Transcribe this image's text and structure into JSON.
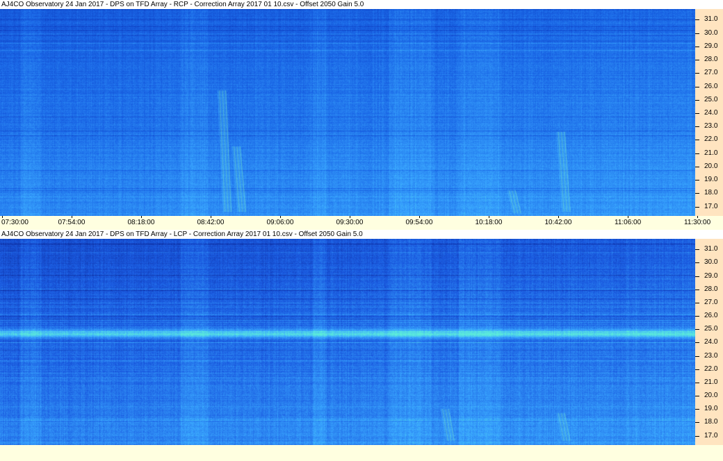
{
  "chart_data": [
    {
      "type": "heatmap",
      "title": "AJ4CO Observatory 24 Jan 2017  -  DPS on TFD Array  -  RCP  -  Correction Array 2017 01 10.csv  -  Offset 2050  Gain 5.0",
      "xlabel": "",
      "ylabel": "",
      "x_ticks": [
        "07:30:00",
        "07:54:00",
        "08:18:00",
        "08:42:00",
        "09:06:00",
        "09:30:00",
        "09:54:00",
        "10:18:00",
        "10:42:00",
        "11:06:00",
        "11:30:00"
      ],
      "y_ticks": [
        "31.0",
        "30.0",
        "29.0",
        "28.0",
        "27.0",
        "26.0",
        "25.0",
        "24.0",
        "23.0",
        "22.0",
        "21.0",
        "20.0",
        "19.0",
        "18.0",
        "17.0"
      ],
      "y_tick_values": [
        31,
        30,
        29,
        28,
        27,
        26,
        25,
        24,
        23,
        22,
        21,
        20,
        19,
        18,
        17
      ],
      "ylim": [
        16.3,
        31.8
      ],
      "xlim_minutes": [
        0,
        240
      ],
      "colors": {
        "deep": "#0a2fb4",
        "mid": "#1a66e6",
        "bright": "#3aa8ff",
        "hot": "#5ef0d8"
      },
      "bursts": [
        {
          "t_min": 78,
          "f_lo": 16.6,
          "f_hi": 25.7
        },
        {
          "t_min": 83,
          "f_lo": 16.6,
          "f_hi": 21.5
        },
        {
          "t_min": 178,
          "f_lo": 16.5,
          "f_hi": 18.2
        },
        {
          "t_min": 195,
          "f_lo": 16.6,
          "f_hi": 22.6
        }
      ]
    },
    {
      "type": "heatmap",
      "title": "AJ4CO Observatory 24 Jan 2017  -  DPS on TFD Array  -  LCP  -  Correction Array 2017 01 10.csv  -  Offset 2050  Gain 5.0",
      "xlabel": "",
      "ylabel": "",
      "x_ticks": [],
      "y_ticks": [
        "31.0",
        "30.0",
        "29.0",
        "28.0",
        "27.0",
        "26.0",
        "25.0",
        "24.0",
        "23.0",
        "22.0",
        "21.0",
        "20.0",
        "19.0",
        "18.0",
        "17.0"
      ],
      "y_tick_values": [
        31,
        30,
        29,
        28,
        27,
        26,
        25,
        24,
        23,
        22,
        21,
        20,
        19,
        18,
        17
      ],
      "ylim": [
        16.3,
        31.8
      ],
      "xlim_minutes": [
        0,
        240
      ],
      "colors": {
        "deep": "#0a1f8c",
        "mid": "#1a5ae0",
        "bright": "#3aa8ff",
        "hot": "#5ef0d8"
      },
      "band_freq": 24.7,
      "bursts": [
        {
          "t_min": 155,
          "f_lo": 16.6,
          "f_hi": 19.0
        },
        {
          "t_min": 195,
          "f_lo": 16.6,
          "f_hi": 18.7
        }
      ]
    }
  ]
}
